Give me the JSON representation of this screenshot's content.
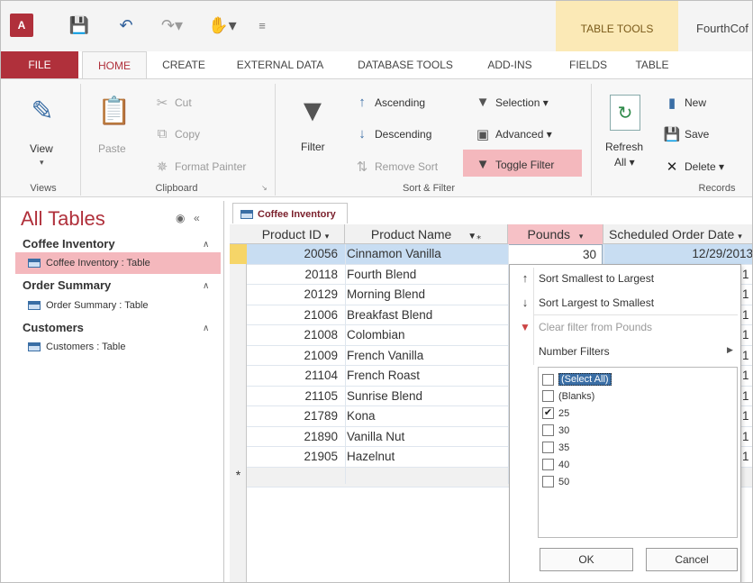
{
  "titlebar": {
    "logo": "A",
    "qat_icons": [
      "save-icon",
      "undo-icon",
      "redo-icon",
      "touch-mode-icon",
      "customize-qat-icon"
    ],
    "table_tools": "TABLE TOOLS",
    "doc_title": "FourthCof"
  },
  "tabs": [
    "FILE",
    "HOME",
    "CREATE",
    "EXTERNAL DATA",
    "DATABASE TOOLS",
    "ADD-INS",
    "FIELDS",
    "TABLE"
  ],
  "ribbon": {
    "views": {
      "view": "View",
      "label": "Views"
    },
    "clipboard": {
      "paste": "Paste",
      "cut": "Cut",
      "copy": "Copy",
      "format_painter": "Format Painter",
      "label": "Clipboard"
    },
    "sort_filter": {
      "filter": "Filter",
      "ascending": "Ascending",
      "descending": "Descending",
      "remove_sort": "Remove Sort",
      "selection": "Selection ▾",
      "advanced": "Advanced ▾",
      "toggle_filter": "Toggle Filter",
      "label": "Sort & Filter"
    },
    "records": {
      "refresh": "Refresh",
      "refresh_all": "All ▾",
      "new": "New",
      "save": "Save",
      "delete": "Delete ▾",
      "label": "Records"
    }
  },
  "nav": {
    "title": "All Tables",
    "groups": [
      {
        "name": "Coffee Inventory",
        "item": "Coffee Inventory : Table"
      },
      {
        "name": "Order Summary",
        "item": "Order Summary : Table"
      },
      {
        "name": "Customers",
        "item": "Customers : Table"
      }
    ]
  },
  "datasheet": {
    "tab": "Coffee Inventory",
    "columns": [
      "Product ID",
      "Product Name",
      "Pounds",
      "Scheduled Order Date"
    ],
    "rows": [
      {
        "id": "20056",
        "name": "Cinnamon Vanilla",
        "pounds": "30",
        "date": "12/29/2013",
        "tail": ""
      },
      {
        "id": "20118",
        "name": "Fourth Blend",
        "pounds": "",
        "date": "",
        "tail": "1"
      },
      {
        "id": "20129",
        "name": "Morning Blend",
        "pounds": "",
        "date": "",
        "tail": "1"
      },
      {
        "id": "21006",
        "name": "Breakfast Blend",
        "pounds": "",
        "date": "",
        "tail": "1"
      },
      {
        "id": "21008",
        "name": "Colombian",
        "pounds": "",
        "date": "",
        "tail": "1"
      },
      {
        "id": "21009",
        "name": "French Vanilla",
        "pounds": "",
        "date": "",
        "tail": "1"
      },
      {
        "id": "21104",
        "name": "French Roast",
        "pounds": "",
        "date": "",
        "tail": "1"
      },
      {
        "id": "21105",
        "name": "Sunrise Blend",
        "pounds": "",
        "date": "",
        "tail": "1"
      },
      {
        "id": "21789",
        "name": "Kona",
        "pounds": "",
        "date": "",
        "tail": "1"
      },
      {
        "id": "21890",
        "name": "Vanilla Nut",
        "pounds": "",
        "date": "",
        "tail": "1"
      },
      {
        "id": "21905",
        "name": "Hazelnut",
        "pounds": "",
        "date": "",
        "tail": "1"
      }
    ],
    "new_row_marker": "*"
  },
  "filter_menu": {
    "sort_smallest": "Sort Smallest to Largest",
    "sort_largest": "Sort Largest to Smallest",
    "clear_filter": "Clear filter from Pounds",
    "number_filters": "Number Filters",
    "values": [
      {
        "label": "(Select All)",
        "checked": false
      },
      {
        "label": "(Blanks)",
        "checked": false
      },
      {
        "label": "25",
        "checked": true
      },
      {
        "label": "30",
        "checked": false
      },
      {
        "label": "35",
        "checked": false
      },
      {
        "label": "40",
        "checked": false
      },
      {
        "label": "50",
        "checked": false
      }
    ],
    "ok": "OK",
    "cancel": "Cancel"
  }
}
